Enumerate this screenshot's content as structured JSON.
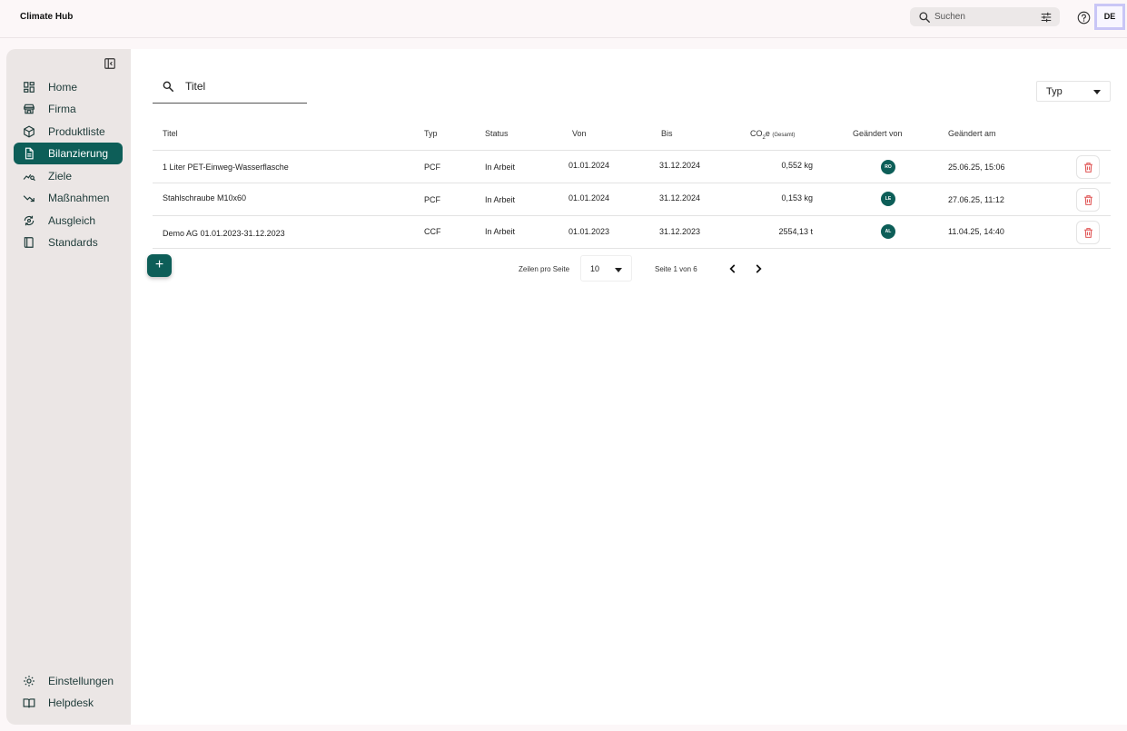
{
  "app": {
    "title": "Climate Hub"
  },
  "header": {
    "search_placeholder": "Suchen",
    "lang": "DE"
  },
  "sidebar": {
    "items": [
      {
        "label": "Home"
      },
      {
        "label": "Firma"
      },
      {
        "label": "Produktliste"
      },
      {
        "label": "Bilanzierung",
        "active": true
      },
      {
        "label": "Ziele"
      },
      {
        "label": "Maßnahmen"
      },
      {
        "label": "Ausgleich"
      },
      {
        "label": "Standards"
      }
    ],
    "bottom": [
      {
        "label": "Einstellungen"
      },
      {
        "label": "Helpdesk"
      }
    ]
  },
  "filters": {
    "search_label": "Titel",
    "type_label": "Typ"
  },
  "table": {
    "columns": {
      "title": "Titel",
      "type": "Typ",
      "status": "Status",
      "from": "Von",
      "to": "Bis",
      "co2_main": "CO",
      "co2_sub": "2",
      "co2_e": "e",
      "co2_small": "(Gesamt)",
      "changed_by": "Geändert von",
      "changed_at": "Geändert am"
    },
    "rows": [
      {
        "title": "1 Liter PET-Einweg-Wasserflasche",
        "type": "PCF",
        "status": "In Arbeit",
        "from": "01.01.2024",
        "to": "31.12.2024",
        "co2": "0,552 kg",
        "user": "RO",
        "changed": "25.06.25, 15:06"
      },
      {
        "title": "Stahlschraube M10x60",
        "type": "PCF",
        "status": "In Arbeit",
        "from": "01.01.2024",
        "to": "31.12.2024",
        "co2": "0,153 kg",
        "user": "LE",
        "changed": "27.06.25, 11:12"
      },
      {
        "title": "Demo AG 01.01.2023-31.12.2023",
        "type": "CCF",
        "status": "In Arbeit",
        "from": "01.01.2023",
        "to": "31.12.2023",
        "co2": "2554,13 t",
        "user": "AL",
        "changed": "11.04.25, 14:40"
      }
    ]
  },
  "pagination": {
    "rows_label": "Zeilen pro Seite",
    "rows_value": "10",
    "page_info": "Seite 1 von 6"
  },
  "colors": {
    "accent": "#0d5e58",
    "danger": "#e05656",
    "sidebar_bg": "#ebe6e5"
  }
}
